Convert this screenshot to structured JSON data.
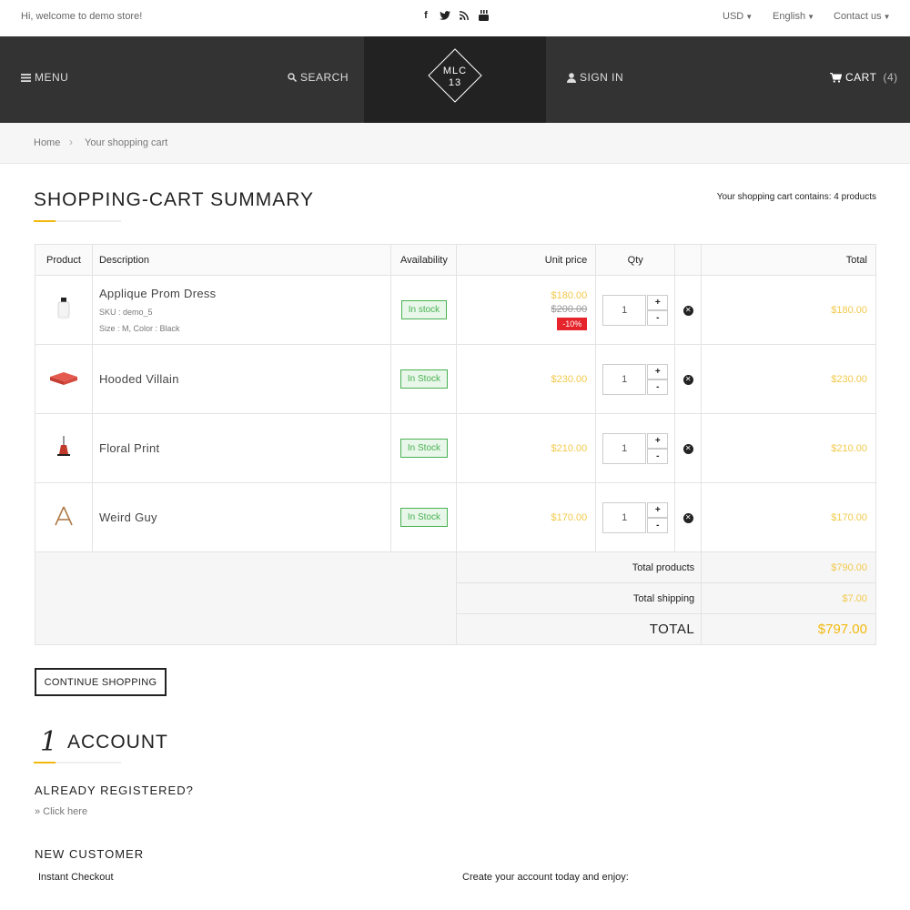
{
  "topbar": {
    "welcome": "Hi, welcome to demo store!",
    "social_icons": [
      "facebook-icon",
      "twitter-icon",
      "rss-icon",
      "youtube-icon"
    ],
    "currency": "USD",
    "language": "English",
    "contact": "Contact us"
  },
  "header": {
    "menu": "MENU",
    "search": "SEARCH",
    "logo_line1": "MLC",
    "logo_line2": "13",
    "signin": "SIGN IN",
    "cart": "CART",
    "cart_count": "(4)"
  },
  "breadcrumb": {
    "home": "Home",
    "separator": "›",
    "current": "Your shopping cart"
  },
  "summary": {
    "title": "SHOPPING-CART SUMMARY",
    "contains": "Your shopping cart contains: 4 products"
  },
  "table": {
    "headers": {
      "product": "Product",
      "description": "Description",
      "availability": "Availability",
      "unit_price": "Unit price",
      "qty": "Qty",
      "total": "Total"
    },
    "rows": [
      {
        "name": "Applique Prom Dress",
        "sku": "SKU : demo_5",
        "attributes": "Size : M, Color : Black",
        "availability": "In stock",
        "price": "$180.00",
        "old_price": "$200.00",
        "discount": "-10%",
        "qty": "1",
        "total": "$180.00"
      },
      {
        "name": "Hooded Villain",
        "availability": "In Stock",
        "price": "$230.00",
        "qty": "1",
        "total": "$230.00"
      },
      {
        "name": "Floral Print",
        "availability": "In Stock",
        "price": "$210.00",
        "qty": "1",
        "total": "$210.00"
      },
      {
        "name": "Weird Guy",
        "availability": "In Stock",
        "price": "$170.00",
        "qty": "1",
        "total": "$170.00"
      }
    ],
    "qty_plus": "+",
    "qty_minus": "-",
    "totals": {
      "products_label": "Total products",
      "products_value": "$790.00",
      "shipping_label": "Total shipping",
      "shipping_value": "$7.00",
      "grand_label": "TOTAL",
      "grand_value": "$797.00"
    }
  },
  "continue_shopping": "CONTINUE SHOPPING",
  "account": {
    "step": "1",
    "title": "ACCOUNT",
    "already_registered": "ALREADY REGISTERED?",
    "click_here": "» Click here",
    "new_customer": "NEW CUSTOMER",
    "instant_checkout": "Instant Checkout",
    "create_account": "Create your account today and enjoy:"
  },
  "colors": {
    "accent": "#f2b90c",
    "price": "#f2c94c",
    "header_bg": "#333333",
    "logo_bg": "#222222",
    "stock_green": "#48b151",
    "discount_red": "#e5242c"
  }
}
